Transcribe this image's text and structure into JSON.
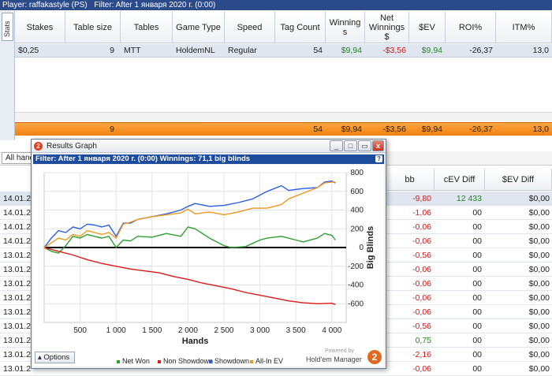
{
  "topbar": {
    "player": "Player: raffakastyle (PS)",
    "filter": "Filter: After 1 января 2020 г. (0:00)"
  },
  "stats_tab": "Stats",
  "top_table": {
    "headers": [
      "Stakes",
      "Table size",
      "Tables",
      "Game Type",
      "Speed",
      "Tag Count",
      "Winnings",
      "Net Winnings $",
      "$EV",
      "ROI%",
      "ITM%"
    ],
    "row": {
      "stakes": "$0,25",
      "table_size": "9",
      "tables": "MTT",
      "game_type": "HoldemNL",
      "speed": "Regular",
      "tag_count": "54",
      "winnings": "$9,94",
      "net_winnings": "-$3,56",
      "ev": "$9,94",
      "roi": "-26,37",
      "itm": "13,0"
    },
    "total": {
      "table_size": "9",
      "tag_count": "54",
      "winnings": "$9,94",
      "net_winnings": "-$3,56",
      "ev": "$9,94",
      "roi": "-26,37",
      "itm": "13,0"
    }
  },
  "bottom": {
    "filter_button": "All hands",
    "headers": [
      "bb",
      "cEV Diff",
      "$EV Diff"
    ],
    "rows": [
      {
        "date": "14.01.2",
        "bb": "-9,80",
        "cev": "12 433",
        "ev": "$0,00",
        "sel": true
      },
      {
        "date": "14.01.2",
        "bb": "-1,06",
        "cev": "00",
        "ev": "$0,00"
      },
      {
        "date": "14.01.2",
        "bb": "-0,06",
        "cev": "00",
        "ev": "$0,00"
      },
      {
        "date": "14.01.2",
        "bb": "-0,06",
        "cev": "00",
        "ev": "$0,00"
      },
      {
        "date": "13.01.2",
        "bb": "-0,56",
        "cev": "00",
        "ev": "$0,00"
      },
      {
        "date": "13.01.2",
        "bb": "-0,06",
        "cev": "00",
        "ev": "$0,00"
      },
      {
        "date": "13.01.2",
        "bb": "-0,06",
        "cev": "00",
        "ev": "$0,00"
      },
      {
        "date": "13.01.2",
        "bb": "-0,06",
        "cev": "00",
        "ev": "$0,00"
      },
      {
        "date": "13.01.2",
        "bb": "-0,06",
        "cev": "00",
        "ev": "$0,00"
      },
      {
        "date": "13.01.2",
        "bb": "-0,56",
        "cev": "00",
        "ev": "$0,00"
      },
      {
        "date": "13.01.2",
        "bb": "0,75",
        "cev": "00",
        "ev": "$0,00"
      },
      {
        "date": "13.01.2",
        "bb": "-2,16",
        "cev": "00",
        "ev": "$0,00"
      },
      {
        "date": "13.01.2",
        "bb": "-0,06",
        "cev": "00",
        "ev": "$0,00"
      }
    ]
  },
  "graph_window": {
    "title": "Results Graph",
    "filter_text": "Filter: After 1 января 2020 г. (0:00) Winnings: 71,1 big blinds",
    "options": "Options",
    "powered_by": "Powered by",
    "brand": "Hold'em Manager",
    "brand_badge": "2",
    "buttons": {
      "minimize": "_",
      "restore": "□",
      "maximize": "▭",
      "close": "x",
      "help": "?"
    }
  },
  "chart_data": {
    "type": "line",
    "xlabel": "Hands",
    "ylabel": "Big Blinds",
    "xlim": [
      0,
      4200
    ],
    "ylim": [
      -800,
      800
    ],
    "x_ticks": [
      500,
      1000,
      1500,
      2000,
      2500,
      3000,
      3500,
      4000
    ],
    "x_tick_labels": [
      "500",
      "1 000",
      "1 500",
      "2 000",
      "2 500",
      "3 000",
      "3 500",
      "4 000"
    ],
    "y_ticks": [
      -600,
      -400,
      -200,
      0,
      200,
      400,
      600,
      800
    ],
    "grid": true,
    "legend_position": "bottom",
    "series": [
      {
        "name": "Net Won",
        "color": "#2ea02e",
        "x": [
          0,
          100,
          200,
          300,
          400,
          500,
          600,
          700,
          800,
          900,
          1000,
          1100,
          1200,
          1300,
          1500,
          1700,
          1900,
          2000,
          2100,
          2300,
          2500,
          2600,
          2800,
          3000,
          3100,
          3300,
          3500,
          3600,
          3800,
          3900,
          4000,
          4050
        ],
        "y": [
          0,
          -40,
          -60,
          20,
          120,
          100,
          140,
          120,
          100,
          120,
          0,
          80,
          70,
          120,
          110,
          150,
          120,
          220,
          200,
          100,
          20,
          0,
          10,
          80,
          100,
          120,
          80,
          60,
          100,
          150,
          130,
          80
        ]
      },
      {
        "name": "Non Showdown",
        "color": "#e01818",
        "x": [
          0,
          200,
          400,
          600,
          800,
          1000,
          1200,
          1400,
          1600,
          1800,
          2000,
          2200,
          2400,
          2600,
          2800,
          3000,
          3200,
          3400,
          3600,
          3800,
          4000,
          4050
        ],
        "y": [
          0,
          -40,
          -80,
          -130,
          -170,
          -200,
          -230,
          -250,
          -270,
          -310,
          -340,
          -380,
          -410,
          -440,
          -480,
          -510,
          -540,
          -570,
          -590,
          -600,
          -595,
          -610
        ]
      },
      {
        "name": "Showdown",
        "color": "#2a5ee8",
        "x": [
          0,
          100,
          200,
          300,
          400,
          500,
          600,
          700,
          800,
          900,
          1000,
          1100,
          1200,
          1300,
          1500,
          1700,
          1900,
          2000,
          2100,
          2300,
          2500,
          2700,
          2900,
          3100,
          3300,
          3400,
          3600,
          3800,
          3900,
          4000,
          4050
        ],
        "y": [
          0,
          100,
          180,
          160,
          220,
          200,
          250,
          240,
          220,
          240,
          120,
          260,
          260,
          300,
          330,
          360,
          400,
          440,
          470,
          440,
          450,
          480,
          520,
          600,
          660,
          610,
          630,
          640,
          700,
          710,
          690
        ]
      },
      {
        "name": "All-In EV",
        "color": "#f0961e",
        "x": [
          0,
          100,
          200,
          300,
          400,
          500,
          600,
          700,
          800,
          900,
          1000,
          1100,
          1200,
          1300,
          1500,
          1700,
          1900,
          2000,
          2100,
          2300,
          2500,
          2700,
          2900,
          3100,
          3300,
          3400,
          3600,
          3800,
          3900,
          4000,
          4050
        ],
        "y": [
          0,
          50,
          100,
          80,
          140,
          120,
          180,
          160,
          140,
          160,
          100,
          250,
          270,
          300,
          330,
          350,
          370,
          410,
          360,
          380,
          350,
          380,
          420,
          420,
          460,
          520,
          580,
          640,
          690,
          700,
          700
        ]
      }
    ]
  }
}
